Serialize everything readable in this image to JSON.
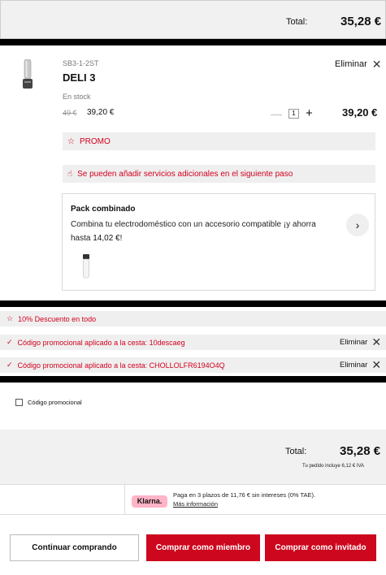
{
  "summary_top": {
    "label": "Total:",
    "value": "35,28 €"
  },
  "product": {
    "sku": "SB3-1-2ST",
    "name": "DELI 3",
    "remove_label": "Eliminar",
    "stock": "En stock",
    "old_price": "49 €",
    "price": "39,20 €",
    "quantity": "1",
    "line_total": "39,20 €"
  },
  "promo_badge": "PROMO",
  "services_notice": "Se pueden añadir servicios adicionales en el siguiente paso",
  "pack": {
    "title": "Pack combinado",
    "description": "Combina tu electrodoméstico con un accesorio compatible ¡y ahorra hasta",
    "amount": "14,02 €",
    "suffix": "!"
  },
  "promotions": {
    "discount": "10% Descuento en todo",
    "applied": [
      {
        "text": "Código promocional aplicado a la cesta: 10descaeg",
        "remove": "Eliminar"
      },
      {
        "text": "Código promocional aplicado a la cesta: CHOLLOLFR6194O4Q",
        "remove": "Eliminar"
      }
    ]
  },
  "coupon_label": "Código promocional",
  "summary_bottom": {
    "label": "Total:",
    "value": "35,28 €",
    "vat_note": "Tu pedido incluye 6,12 € IVA"
  },
  "klarna": {
    "logo": "Klarna.",
    "text": "Paga en 3 plazos de 11,76 € sin intereses (0% TAE).",
    "more": "Más información"
  },
  "buttons": {
    "continue": "Continuar comprando",
    "member": "Comprar como miembro",
    "guest": "Comprar como invitado"
  },
  "colors": {
    "accent": "#cc071e",
    "promo_text": "#d2001e",
    "band": "#efefef",
    "klarna": "#ffb3c7"
  }
}
